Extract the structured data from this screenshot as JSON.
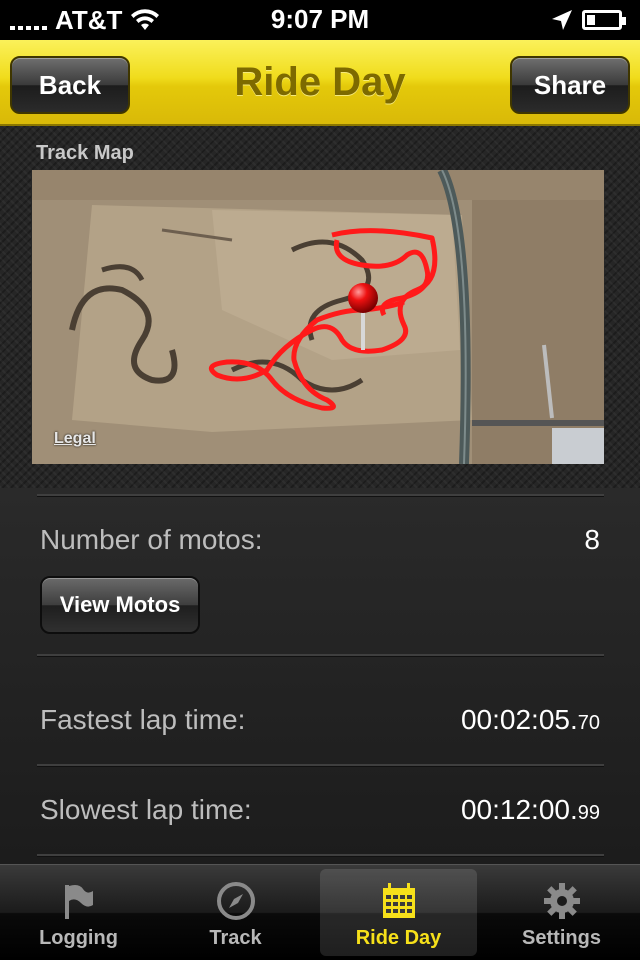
{
  "status_bar": {
    "carrier": "AT&T",
    "time": "9:07 PM"
  },
  "nav": {
    "title": "Ride Day",
    "back_label": "Back",
    "share_label": "Share"
  },
  "map": {
    "section_label": "Track Map",
    "legal_label": "Legal"
  },
  "stats": {
    "motos_label": "Number of motos:",
    "motos_value": "8",
    "view_motos_label": "View Motos",
    "fastest_label": "Fastest lap time:",
    "fastest_main": "00:02:05.",
    "fastest_fraction": "70",
    "slowest_label": "Slowest lap time:",
    "slowest_main": "00:12:00.",
    "slowest_fraction": "99"
  },
  "tabs": [
    {
      "label": "Logging",
      "icon": "flag-icon"
    },
    {
      "label": "Track",
      "icon": "compass-icon"
    },
    {
      "label": "Ride Day",
      "icon": "calendar-icon",
      "active": true
    },
    {
      "label": "Settings",
      "icon": "gear-icon"
    }
  ],
  "colors": {
    "nav_yellow": "#f0dc1c",
    "title_olive": "#7d6a00",
    "active_tab": "#f6e01a",
    "track_line": "#ff1a1a"
  }
}
